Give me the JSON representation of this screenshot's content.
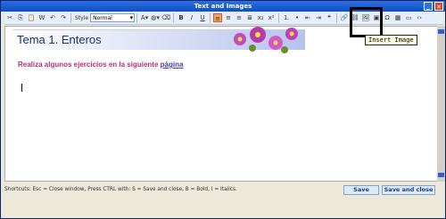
{
  "window": {
    "title": "Text and Images",
    "close_glyph": "✕",
    "min_glyph": "_"
  },
  "toolbar": {
    "style_label": "Style",
    "style_value": "Normal",
    "buttons": [
      "cut-icon",
      "copy-icon",
      "paste-icon",
      "paste-word-icon",
      "undo-icon",
      "redo-icon"
    ],
    "format": [
      "B",
      "I",
      "U"
    ]
  },
  "editor": {
    "heading": "Tema 1. Enteros",
    "paragraph_text": "Realiza algunos ejercicios en la siguiente ",
    "paragraph_link": "página"
  },
  "tooltip": {
    "text": "Insert Image"
  },
  "footer": {
    "shortcuts": "Shortcuts: Esc = Close window, Press CTRL with: S = Save and close, B = Bold, I = Italics.",
    "save_label": "Save",
    "save_close_label": "Save and close"
  },
  "colors": {
    "heading": "#1d2e6f",
    "paragraph": "#b3307a",
    "link": "#4a3aa8",
    "tooltip_bg": "#ffffe1"
  }
}
